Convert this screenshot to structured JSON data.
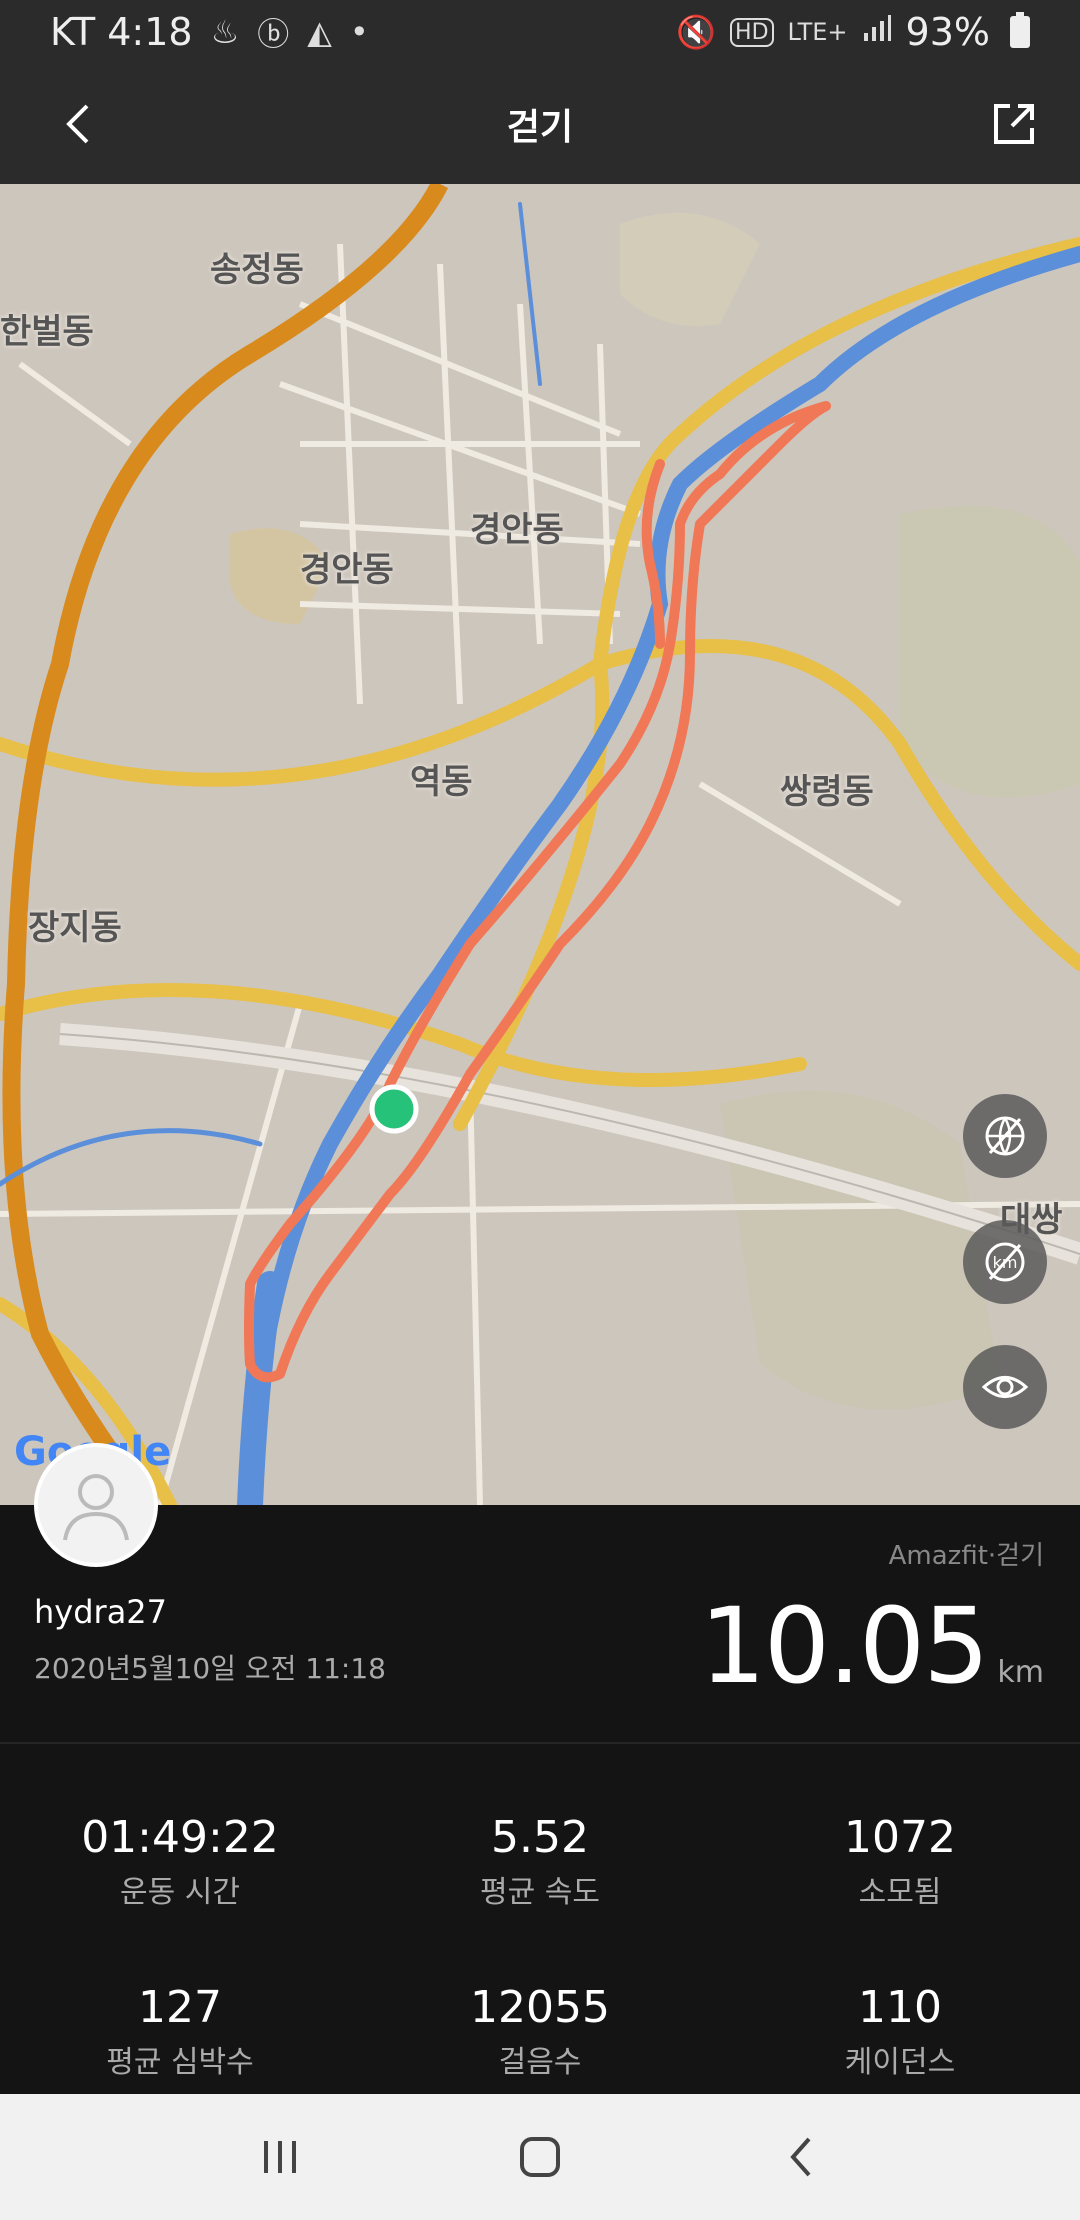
{
  "status_bar": {
    "carrier_time": "KT 4:18",
    "network": "LTE+",
    "battery": "93%"
  },
  "header": {
    "title": "걷기"
  },
  "map": {
    "labels": [
      "송정동",
      "한벌동",
      "경안동",
      "경안동",
      "역동",
      "쌍령동",
      "장지동",
      "대쌍"
    ],
    "google_logo": "Google",
    "route_color": "#f07857",
    "river_color": "#5b8fd9",
    "road_color": "#e8bf47",
    "highway_color": "#d88a1c"
  },
  "activity": {
    "username": "hydra27",
    "datetime": "2020년5월10일 오전 11:18",
    "source": "Amazfit·걷기",
    "distance": "10.05",
    "distance_unit": "km"
  },
  "stats": [
    {
      "value": "01:49:22",
      "label": "운동 시간"
    },
    {
      "value": "5.52",
      "label": "평균 속도"
    },
    {
      "value": "1072",
      "label": "소모됨"
    },
    {
      "value": "127",
      "label": "평균 심박수"
    },
    {
      "value": "12055",
      "label": "걸음수"
    },
    {
      "value": "110",
      "label": "케이던스"
    }
  ],
  "icons": {
    "back": "back-arrow-icon",
    "share": "share-icon",
    "map_type": "globe-off-icon",
    "unit": "km-off-icon",
    "visibility": "eye-icon"
  }
}
